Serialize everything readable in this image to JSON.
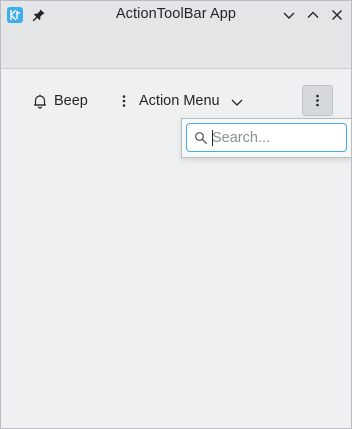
{
  "window": {
    "title": "ActionToolBar App"
  },
  "toolbar": {
    "beep_label": "Beep",
    "action_menu_label": "Action Menu"
  },
  "popup": {
    "search_placeholder": "Search..."
  },
  "icons": {
    "app": "kde-logo-icon",
    "pin": "pin-icon",
    "minimize": "chevron-down-icon",
    "maximize": "chevron-up-icon",
    "close": "close-icon",
    "beep": "bell-icon",
    "action_menu": "kebab-menu-icon",
    "dropdown": "chevron-down-icon",
    "overflow": "kebab-menu-icon",
    "search": "search-icon"
  },
  "colors": {
    "accent": "#3daee9",
    "window_bg": "#eff0f1",
    "header_bg": "#e3e5e7",
    "text": "#232629"
  }
}
